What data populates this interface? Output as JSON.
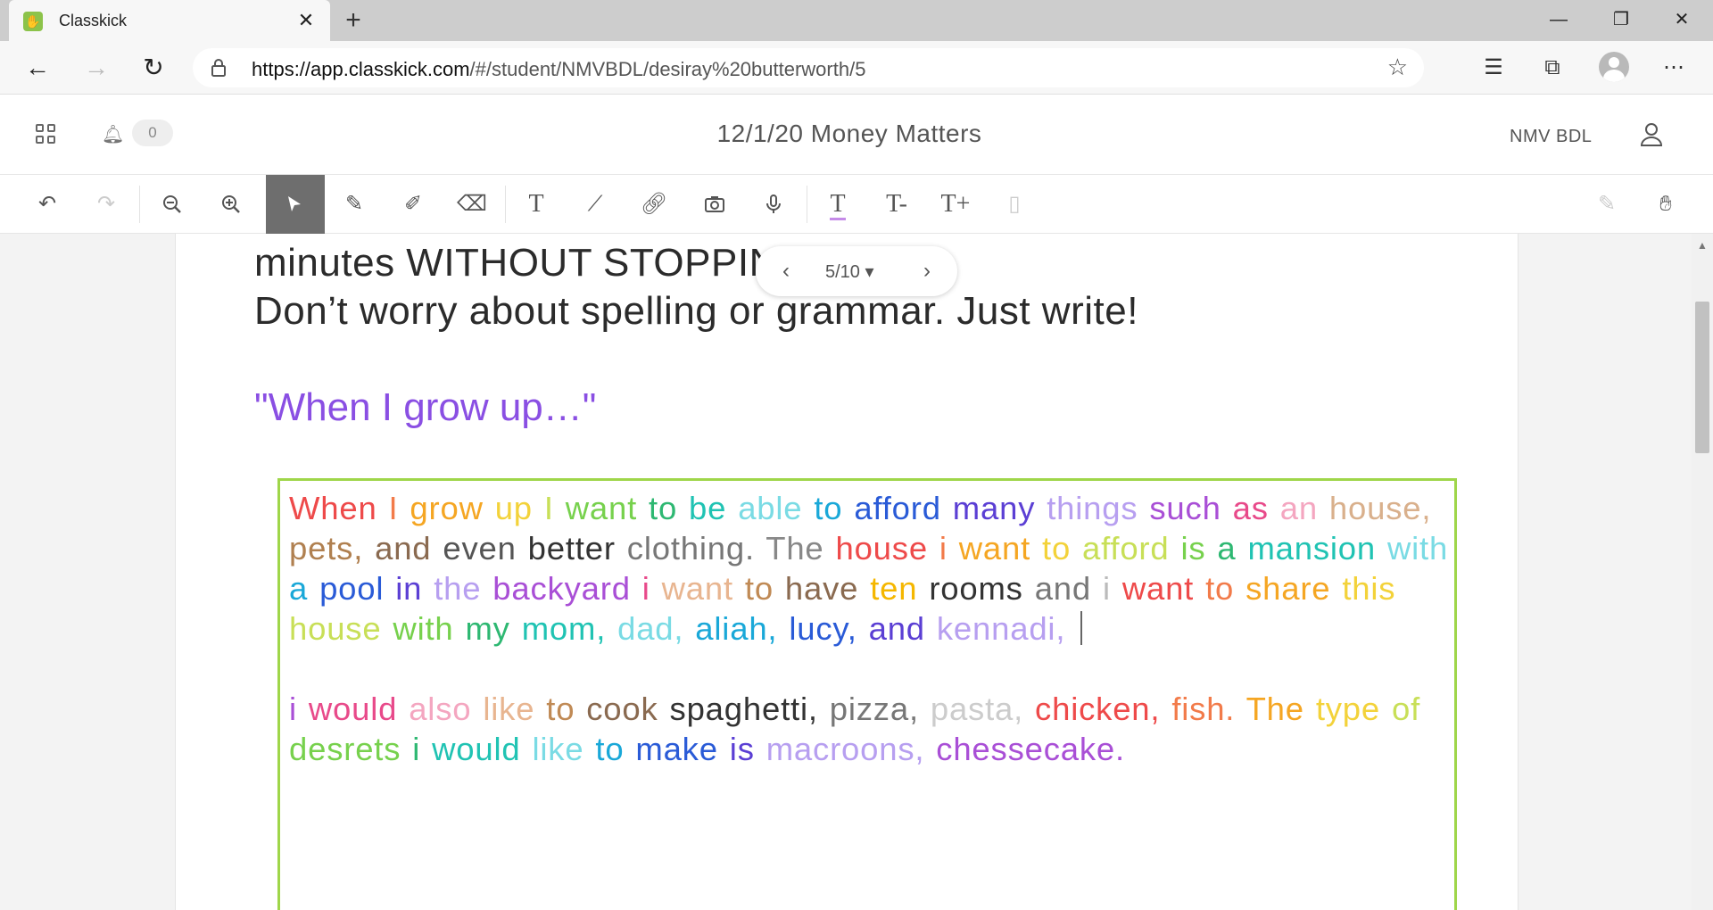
{
  "browser": {
    "tab_title": "Classkick",
    "url_host": "https://app.classkick.com",
    "url_path": "/#/student/NMVBDL/desiray%20butterworth/5"
  },
  "header": {
    "notification_count": "0",
    "assignment_title": "12/1/20 Money Matters",
    "class_name": "NMV BDL"
  },
  "pager": {
    "label": "5/10"
  },
  "prompt": {
    "line1": "minutes WITHOUT STOPPING",
    "line2": "Don’t worry about spelling or grammar. Just write!",
    "starter": "\"When I grow up…\""
  },
  "answer": {
    "paragraphs": [
      [
        [
          "When",
          "#ee4a4a"
        ],
        [
          "I",
          "#f27b4a"
        ],
        [
          "grow",
          "#f5a623"
        ],
        [
          "up",
          "#f3d23a"
        ],
        [
          "I",
          "#c8df57"
        ],
        [
          "want",
          "#77d14d"
        ],
        [
          "to",
          "#2eb872"
        ],
        [
          "be",
          "#20c3b3"
        ],
        [
          "able",
          "#7adbe4"
        ],
        [
          "to",
          "#1aa8d8"
        ],
        [
          "afford",
          "#2a5bd7"
        ],
        [
          "many",
          "#5b3fd4"
        ],
        [
          "things",
          "#b79ff0"
        ],
        [
          "such",
          "#a94fd6"
        ],
        [
          "as",
          "#e84a8a"
        ],
        [
          "an",
          "#f4a6c0"
        ],
        [
          "house,",
          "#d9b08c"
        ],
        [
          "pets,",
          "#b08050"
        ],
        [
          "and",
          "#8a6a50"
        ],
        [
          "even",
          "#555555"
        ],
        [
          "better",
          "#333333"
        ],
        [
          "clothing.",
          "#777777"
        ],
        [
          "The",
          "#888888"
        ],
        [
          "house",
          "#ee4a4a"
        ],
        [
          "i",
          "#f27b4a"
        ],
        [
          "want",
          "#f5a623"
        ],
        [
          "to",
          "#f3d23a"
        ],
        [
          "afford",
          "#c8df57"
        ],
        [
          "is",
          "#77d14d"
        ],
        [
          "a",
          "#2eb872"
        ],
        [
          "mansion",
          "#20c3b3"
        ],
        [
          "with",
          "#7adbe4"
        ],
        [
          "a",
          "#1aa8d8"
        ],
        [
          "pool",
          "#2a5bd7"
        ],
        [
          "in",
          "#5b3fd4"
        ],
        [
          "the",
          "#b79ff0"
        ],
        [
          "backyard",
          "#a94fd6"
        ],
        [
          "i",
          "#e84a8a"
        ],
        [
          "want",
          "#e8b590"
        ],
        [
          "to",
          "#c08a55"
        ],
        [
          "have",
          "#8a6a50"
        ],
        [
          "ten",
          "#f5b700"
        ],
        [
          "rooms",
          "#333333"
        ],
        [
          "and",
          "#777777"
        ],
        [
          "i",
          "#bbbbbb"
        ],
        [
          "want",
          "#ee4a4a"
        ],
        [
          "to",
          "#f27b4a"
        ],
        [
          "share",
          "#f5a623"
        ],
        [
          "this",
          "#f3d23a"
        ],
        [
          "house",
          "#c8df57"
        ],
        [
          "with",
          "#77d14d"
        ],
        [
          "my",
          "#2eb872"
        ],
        [
          "mom,",
          "#20c3b3"
        ],
        [
          "dad,",
          "#7adbe4"
        ],
        [
          "aliah,",
          "#1aa8d8"
        ],
        [
          "lucy,",
          "#2a5bd7"
        ],
        [
          "and",
          "#5b3fd4"
        ],
        [
          "kennadi,",
          "#b79ff0"
        ]
      ],
      [],
      [
        [
          "i",
          "#a94fd6"
        ],
        [
          "would",
          "#e84a8a"
        ],
        [
          "also",
          "#f4a6c0"
        ],
        [
          "like",
          "#e8b590"
        ],
        [
          "to",
          "#c08a55"
        ],
        [
          "cook",
          "#8a6a50"
        ],
        [
          "spaghetti,",
          "#333333"
        ],
        [
          "pizza,",
          "#777777"
        ],
        [
          "pasta,",
          "#cccccc"
        ],
        [
          "chicken,",
          "#ee4a4a"
        ],
        [
          "fish.",
          "#f27b4a"
        ],
        [
          "The",
          "#f5a623"
        ],
        [
          "type",
          "#f3d23a"
        ],
        [
          "of",
          "#c8df57"
        ],
        [
          "desrets",
          "#77d14d"
        ],
        [
          "i",
          "#2eb872"
        ],
        [
          "would",
          "#20c3b3"
        ],
        [
          "like",
          "#7adbe4"
        ],
        [
          "to",
          "#1aa8d8"
        ],
        [
          "make",
          "#2a5bd7"
        ],
        [
          "is",
          "#5b3fd4"
        ],
        [
          "macroons,",
          "#b79ff0"
        ],
        [
          "chessecake.",
          "#a94fd6"
        ]
      ]
    ]
  }
}
